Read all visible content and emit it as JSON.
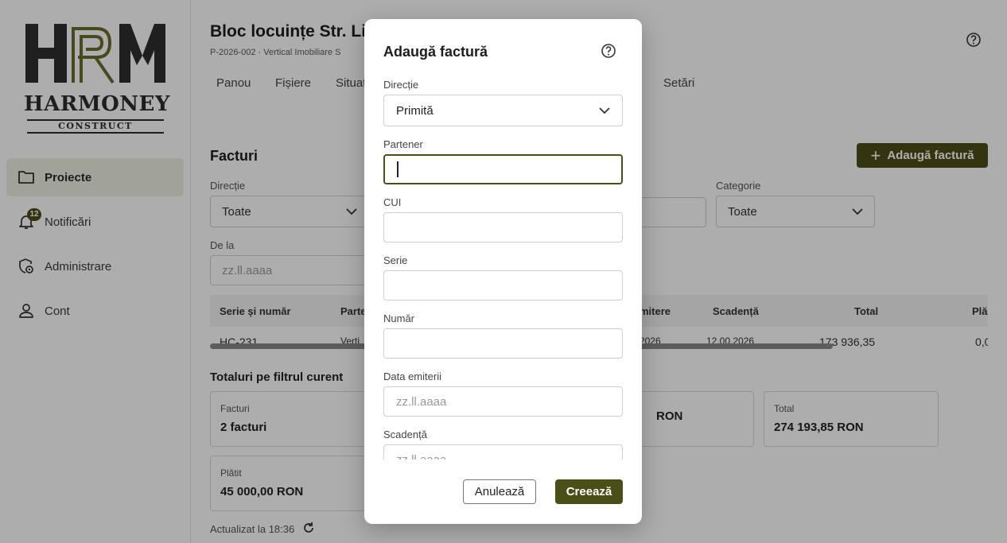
{
  "brand": {
    "logo_letters": "HRM",
    "name": "HARMONEY",
    "tagline": "CONSTRUCT",
    "accent": "#4a4f17"
  },
  "sidebar": {
    "items": [
      {
        "label": "Proiecte",
        "icon": "folder-icon",
        "active": true
      },
      {
        "label": "Notificări",
        "icon": "bell-icon",
        "badge": "12"
      },
      {
        "label": "Administrare",
        "icon": "admin-settings-icon"
      },
      {
        "label": "Cont",
        "icon": "person-icon"
      }
    ]
  },
  "project": {
    "title": "Bloc locuințe Str. Li",
    "subtitle": "P-2026-002 · Vertical Imobiliare S"
  },
  "tabs": [
    "Panou",
    "Fișiere",
    "Situat",
    "Setări"
  ],
  "invoices": {
    "title": "Facturi",
    "add_label": "Adaugă factură",
    "filters": {
      "direction_label": "Direcție",
      "direction_value": "Toate",
      "category_label": "Categorie",
      "category_value": "Toate",
      "from_label": "De la",
      "from_placeholder": "zz.ll.aaaa"
    },
    "columns": [
      "Serie și număr",
      "Parte",
      "mitere",
      "Scadență",
      "Total",
      "Plă"
    ],
    "row": [
      "HC-231",
      "Verti",
      "2026",
      "12.00.2026",
      "173 936,35",
      "0,0"
    ]
  },
  "totals": {
    "title": "Totaluri pe filtrul curent",
    "cards": [
      {
        "label": "Facturi",
        "value": "2 facturi"
      },
      {
        "label": "",
        "value": "RON"
      },
      {
        "label": "Total",
        "value": "274 193,85 RON"
      },
      {
        "label": "Plătit",
        "value": "45 000,00 RON"
      }
    ],
    "updated": "Actualizat la 18:36"
  },
  "modal": {
    "title": "Adaugă factură",
    "fields": {
      "direction_label": "Direcție",
      "direction_value": "Primită",
      "partner_label": "Partener",
      "cui_label": "CUI",
      "series_label": "Serie",
      "number_label": "Număr",
      "issue_label": "Data emiterii",
      "issue_placeholder": "zz.ll.aaaa",
      "due_label": "Scadență",
      "due_placeholder": "zz.ll.aaaa"
    },
    "cancel_label": "Anulează",
    "create_label": "Creează"
  }
}
